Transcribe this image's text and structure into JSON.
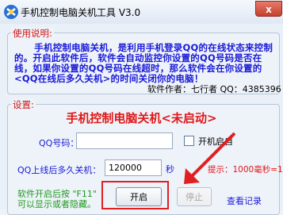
{
  "window": {
    "title": "手机控制电脑关机工具 V3.0",
    "close_label": "x"
  },
  "info": {
    "legend": "使用说明:",
    "description": "手机控制电脑关机，是利用手机登录QQ的在线状态来控制的。开启此软件后，软件会自动监控你设置的QQ号码是否在线，如果你设置的QQ号码在线超时，那么软件会在你设置的<QQ在线后多久关机>的时间关闭你的电脑！",
    "author": "软件作者：七行者 QQ：4385396"
  },
  "settings": {
    "legend": "设置:",
    "status_title": "手机控制电脑关机<未启动>",
    "qq_label": "QQ号码：",
    "qq_value": "",
    "checkbox_label": "开机启自",
    "checked": false,
    "delay_label": "QQ上线后多久关机：",
    "delay_value": "120000",
    "unit_label": "秒",
    "hint": "提示：1000毫秒=1秒",
    "footer_line1": "软件开启后按 \"F11\"",
    "footer_line2": "可以显示或者隐藏。",
    "start_button": "开启",
    "stop_button": "停止",
    "log_link": "查看记录"
  },
  "colors": {
    "accent_blue": "#1a1ad6",
    "alert_red": "#e01818",
    "hint_green": "#1d9a1d"
  }
}
